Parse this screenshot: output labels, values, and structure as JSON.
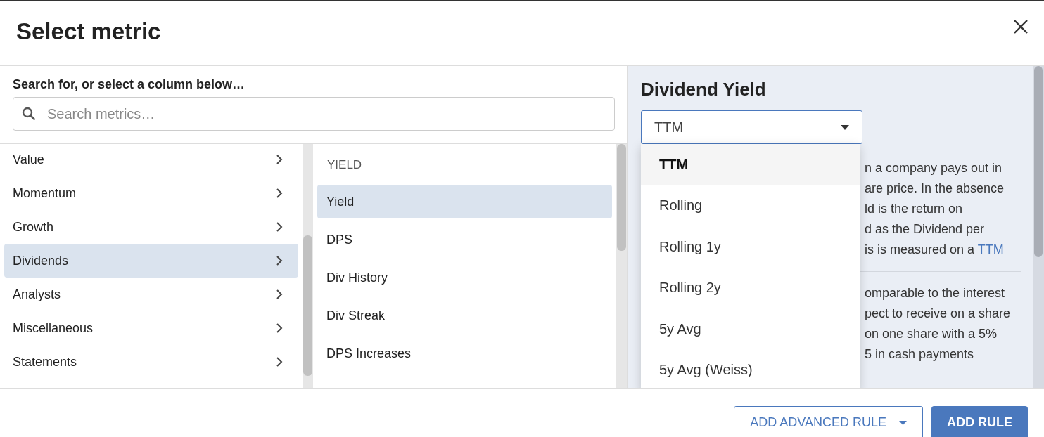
{
  "dialog": {
    "title": "Select metric"
  },
  "search": {
    "label": "Search for, or select a column below…",
    "placeholder": "Search metrics…"
  },
  "categories": [
    {
      "label": "Value",
      "selected": false
    },
    {
      "label": "Momentum",
      "selected": false
    },
    {
      "label": "Growth",
      "selected": false
    },
    {
      "label": "Dividends",
      "selected": true
    },
    {
      "label": "Analysts",
      "selected": false
    },
    {
      "label": "Miscellaneous",
      "selected": false
    },
    {
      "label": "Statements",
      "selected": false
    }
  ],
  "metrics": {
    "heading": "YIELD",
    "items": [
      {
        "label": "Yield",
        "selected": true
      },
      {
        "label": "DPS",
        "selected": false
      },
      {
        "label": "Div History",
        "selected": false
      },
      {
        "label": "Div Streak",
        "selected": false
      },
      {
        "label": "DPS Increases",
        "selected": false
      }
    ]
  },
  "detail": {
    "title": "Dividend Yield",
    "period_select": {
      "value": "TTM",
      "expanded": true,
      "options": [
        {
          "label": "TTM",
          "selected": true
        },
        {
          "label": "Rolling",
          "selected": false
        },
        {
          "label": "Rolling 1y",
          "selected": false
        },
        {
          "label": "Rolling 2y",
          "selected": false
        },
        {
          "label": "5y Avg",
          "selected": false
        },
        {
          "label": "5y Avg (Weiss)",
          "selected": false
        }
      ]
    },
    "paragraphs": [
      [
        {
          "text": "n a company pays out in"
        },
        {
          "text": "are price. In the absence"
        },
        {
          "text": "ld is the return on"
        },
        {
          "text": "d as the Dividend per"
        },
        {
          "text": "is is measured on a ",
          "link": "TTM"
        }
      ],
      [
        {
          "text": "omparable to the interest"
        },
        {
          "text": "pect to receive on a share"
        },
        {
          "text": "on one share with a 5%"
        },
        {
          "text": "5 in cash payments"
        }
      ]
    ]
  },
  "buttons": [
    {
      "label": "ADD ADVANCED RULE",
      "kind": "dropdown"
    },
    {
      "label": "ADD RULE",
      "kind": "primary"
    }
  ]
}
